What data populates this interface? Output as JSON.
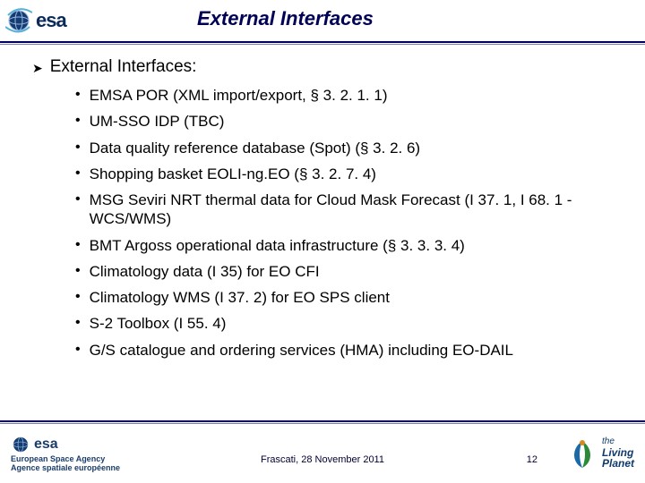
{
  "header": {
    "logo_word": "esa",
    "title": "External Interfaces"
  },
  "content": {
    "heading": "External Interfaces:",
    "bullets": [
      "EMSA POR (XML import/export, § 3. 2. 1. 1)",
      "UM-SSO IDP (TBC)",
      "Data quality reference database (Spot) (§ 3. 2. 6)",
      "Shopping basket EOLI-ng.EO (§ 3. 2. 7. 4)",
      "MSG Seviri NRT thermal data for Cloud Mask Forecast (I 37. 1, I 68. 1 - WCS/WMS)",
      "BMT Argoss operational data infrastructure (§ 3. 3. 3. 4)",
      "Climatology data (I 35) for EO CFI",
      "Climatology WMS (I 37. 2) for EO SPS client",
      "S-2 Toolbox (I 55. 4)",
      "G/S catalogue and ordering services (HMA) including EO-DAIL"
    ]
  },
  "footer": {
    "agency_en": "European Space Agency",
    "agency_fr": "Agence spatiale européenne",
    "location": "Frascati, 28 November 2011",
    "page": "12",
    "living_the": "the",
    "living_title": "Living\nPlanet"
  }
}
